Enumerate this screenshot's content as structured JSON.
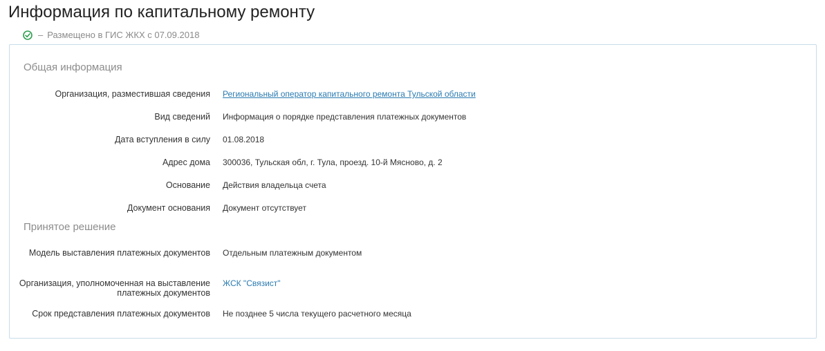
{
  "header": {
    "title": "Информация по капитальному ремонту",
    "status_dash": "–",
    "status_text": "Размещено в ГИС ЖКХ с 07.09.2018",
    "status_color": "#2e9e4f"
  },
  "sections": {
    "general": {
      "title": "Общая информация",
      "rows": [
        {
          "label": "Организация, разместившая сведения",
          "value": "Региональный оператор капитального ремонта Тульской области"
        },
        {
          "label": "Вид сведений",
          "value": "Информация о порядке представления платежных документов"
        },
        {
          "label": "Дата вступления в силу",
          "value": "01.08.2018"
        },
        {
          "label": "Адрес дома",
          "value": "300036, Тульская обл, г. Тула, проезд. 10-й Мясново, д. 2"
        },
        {
          "label": "Основание",
          "value": "Действия владельца счета"
        },
        {
          "label": "Документ основания",
          "value": "Документ отсутствует"
        }
      ]
    },
    "decision": {
      "title": "Принятое решение",
      "rows": [
        {
          "label": "Модель выставления платежных документов",
          "value": "Отдельным платежным документом"
        },
        {
          "label": "Организация, уполномоченная на выставление платежных документов",
          "value": "ЖСК \"Связист\""
        },
        {
          "label": "Срок представления платежных документов",
          "value": "Не позднее 5 числа текущего расчетного месяца"
        }
      ]
    }
  },
  "colors": {
    "link": "#2a7ab0",
    "panel_border": "#c7dcea"
  }
}
